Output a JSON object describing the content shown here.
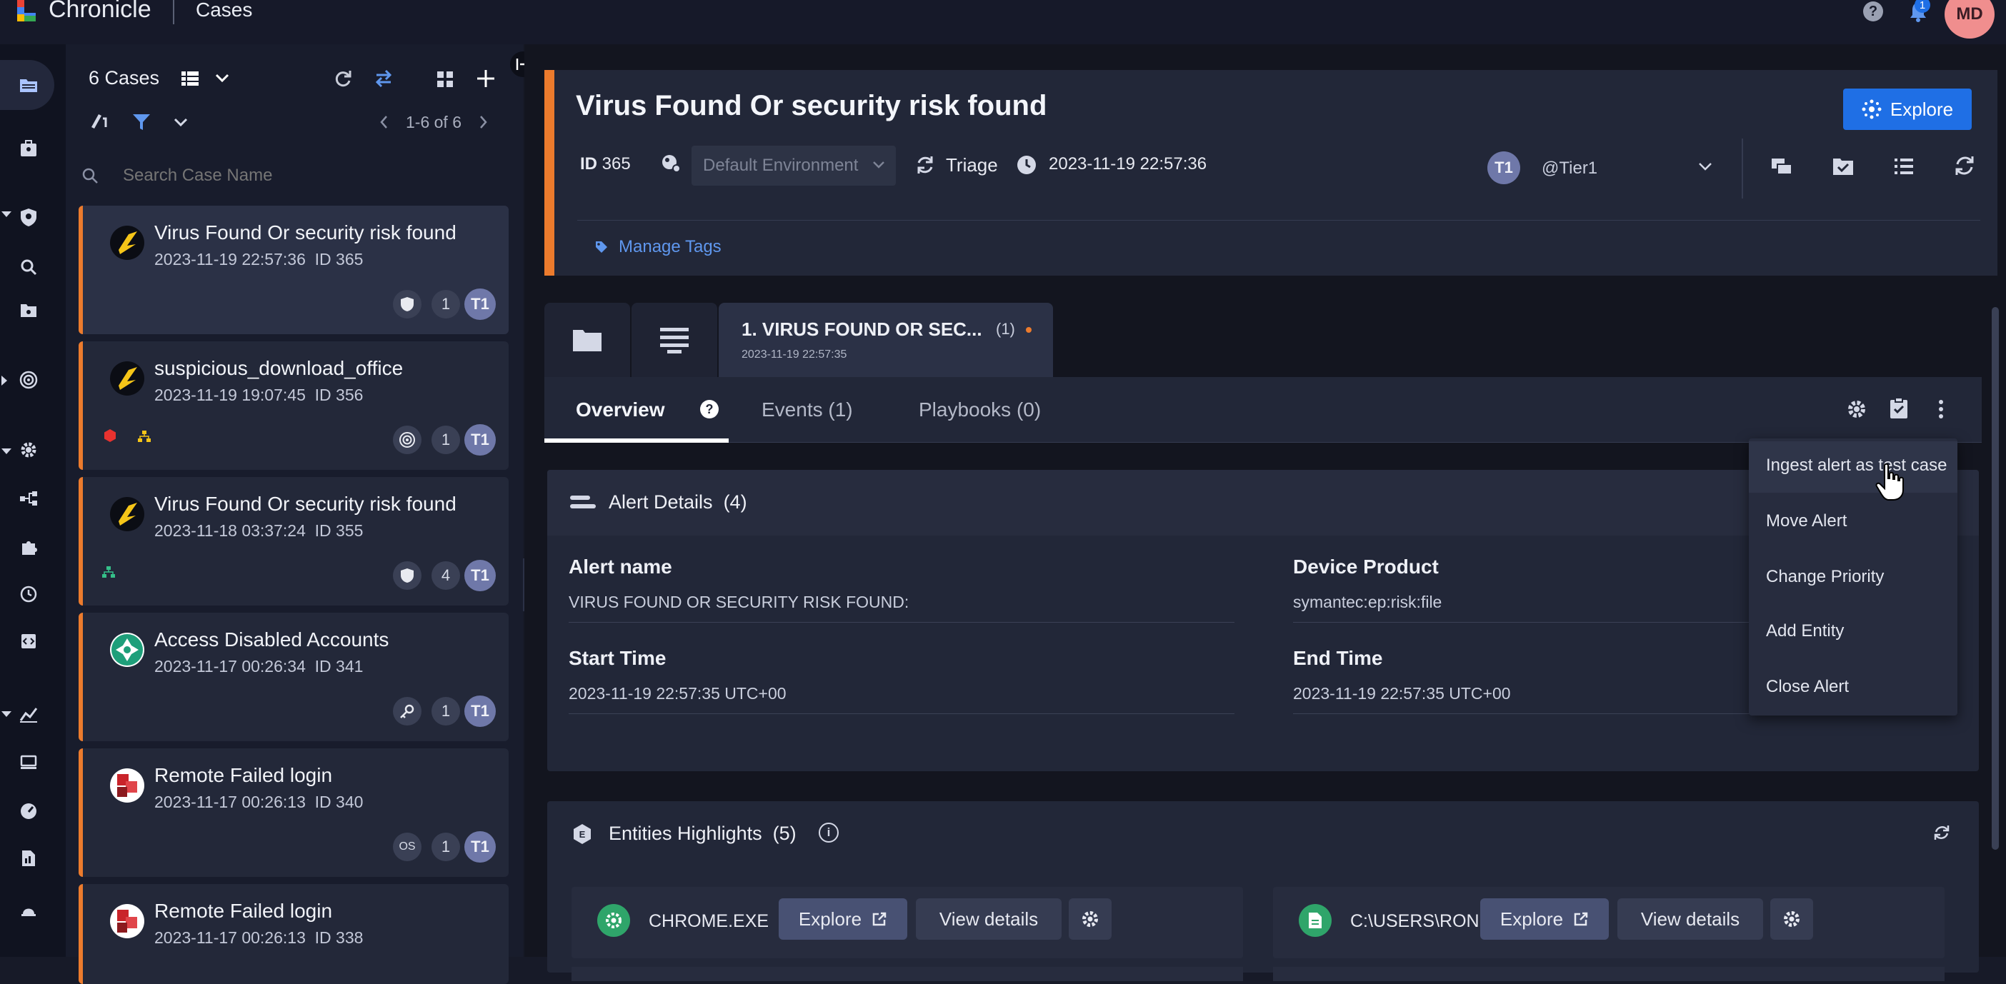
{
  "app": {
    "name": "Chronicle",
    "section": "Cases"
  },
  "topbar": {
    "help_icon": "help-circle-icon",
    "notifications_count": "1",
    "user_initials": "MD"
  },
  "case_list": {
    "count_label": "6 Cases",
    "pagination": "1-6 of 6",
    "search_placeholder": "Search Case Name",
    "cases": [
      {
        "title": "Virus Found Or security risk found",
        "date": "2023-11-19 22:57:36",
        "id": "ID 365",
        "alerts": "1",
        "tier": "T1",
        "badge_icon": "shield-icon"
      },
      {
        "title": "suspicious_download_office",
        "date": "2023-11-19 19:07:45",
        "id": "ID 356",
        "alerts": "1",
        "tier": "T1",
        "badge_icon": "target-icon"
      },
      {
        "title": "Virus Found Or security risk found",
        "date": "2023-11-18 03:37:24",
        "id": "ID 355",
        "alerts": "4",
        "tier": "T1",
        "badge_icon": "shield-icon"
      },
      {
        "title": "Access Disabled Accounts",
        "date": "2023-11-17 00:26:34",
        "id": "ID 341",
        "alerts": "1",
        "tier": "T1",
        "badge_icon": "key-icon"
      },
      {
        "title": "Remote Failed login",
        "date": "2023-11-17 00:26:13",
        "id": "ID 340",
        "alerts": "1",
        "tier": "T1",
        "badge_text": "OS"
      },
      {
        "title": "Remote Failed login",
        "date": "2023-11-17 00:26:13",
        "id": "ID 338"
      }
    ]
  },
  "case_header": {
    "title": "Virus Found Or security risk found",
    "id_label": "ID",
    "id_value": "365",
    "environment": "Default Environment",
    "stage": "Triage",
    "timestamp": "2023-11-19 22:57:36",
    "assignee_badge": "T1",
    "assignee": "@Tier1",
    "explore_label": "Explore",
    "manage_tags_label": "Manage Tags"
  },
  "alert_tab": {
    "title": "1. VIRUS FOUND OR SEC...",
    "count": "(1)",
    "date": "2023-11-19 22:57:35"
  },
  "detail_tabs": [
    {
      "label": "Overview",
      "active": true
    },
    {
      "label": "Events (1)",
      "active": false
    },
    {
      "label": "Playbooks (0)",
      "active": false
    }
  ],
  "alert_details": {
    "title": "Alert Details",
    "count": "(4)",
    "fields": {
      "alert_name_label": "Alert name",
      "alert_name_value": "VIRUS FOUND OR SECURITY RISK FOUND:",
      "device_product_label": "Device Product",
      "device_product_value": "symantec:ep:risk:file",
      "start_time_label": "Start Time",
      "start_time_value": "2023-11-19 22:57:35 UTC+00",
      "end_time_label": "End Time",
      "end_time_value": "2023-11-19 22:57:35 UTC+00"
    }
  },
  "context_menu": {
    "items": [
      "Ingest alert as test case",
      "Move Alert",
      "Change Priority",
      "Add Entity",
      "Close Alert"
    ]
  },
  "entities": {
    "title": "Entities Highlights",
    "count": "(5)",
    "rows": [
      {
        "name": "CHROME.EXE",
        "explore": "Explore",
        "view": "View details"
      },
      {
        "name": "C:\\USERS\\RONI\\APP...",
        "explore": "Explore",
        "view": "View details"
      }
    ]
  },
  "colors": {
    "accent_orange": "#ec7b2d",
    "primary_blue": "#1f6fe5",
    "tier_badge": "#6f78a9",
    "link_blue": "#5f97ee"
  }
}
